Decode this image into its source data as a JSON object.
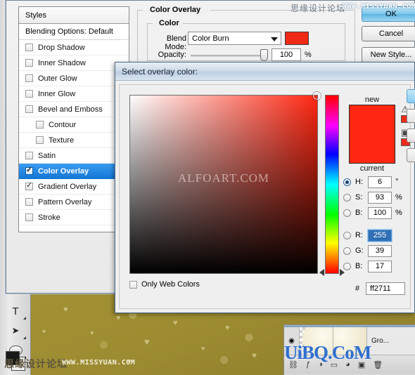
{
  "canvas": {
    "watermark_top_cn": "思缘设计论坛",
    "watermark_top_url": "WWW.MISSYUAN.COM",
    "watermark_bottom_cn": "思缘设计论坛",
    "watermark_bottom_url": "WWW.MISSYUAN.COM",
    "watermark_layers": "UiBQ.CoM"
  },
  "toolbar": {
    "tools": [
      {
        "name": "type-tool",
        "glyph": "T"
      },
      {
        "name": "path-selection-tool",
        "glyph": "➤"
      },
      {
        "name": "ellipse-shape-tool",
        "glyph": ""
      }
    ]
  },
  "layer_style": {
    "styles_panel": {
      "header": "Styles",
      "blending_options": "Blending Options: Default",
      "items": [
        {
          "label": "Drop Shadow",
          "checked": false,
          "selected": false,
          "indent": false
        },
        {
          "label": "Inner Shadow",
          "checked": false,
          "selected": false,
          "indent": false
        },
        {
          "label": "Outer Glow",
          "checked": false,
          "selected": false,
          "indent": false
        },
        {
          "label": "Inner Glow",
          "checked": false,
          "selected": false,
          "indent": false
        },
        {
          "label": "Bevel and Emboss",
          "checked": false,
          "selected": false,
          "indent": false
        },
        {
          "label": "Contour",
          "checked": false,
          "selected": false,
          "indent": true
        },
        {
          "label": "Texture",
          "checked": false,
          "selected": false,
          "indent": true
        },
        {
          "label": "Satin",
          "checked": false,
          "selected": false,
          "indent": false
        },
        {
          "label": "Color Overlay",
          "checked": true,
          "selected": true,
          "indent": false
        },
        {
          "label": "Gradient Overlay",
          "checked": true,
          "selected": false,
          "indent": false
        },
        {
          "label": "Pattern Overlay",
          "checked": false,
          "selected": false,
          "indent": false
        },
        {
          "label": "Stroke",
          "checked": false,
          "selected": false,
          "indent": false
        }
      ]
    },
    "color_overlay": {
      "section_title": "Color Overlay",
      "group_title": "Color",
      "blend_mode_label": "Blend Mode:",
      "blend_mode_value": "Color Burn",
      "blend_swatch_color": "#ee2a17",
      "opacity_label": "Opacity:",
      "opacity_value": "100",
      "opacity_unit": "%"
    },
    "buttons": {
      "ok": "OK",
      "cancel": "Cancel",
      "new_style": "New Style..."
    }
  },
  "color_picker": {
    "title": "Select overlay color:",
    "preview": {
      "new_label": "new",
      "current_label": "current",
      "new_color": "#ff2711",
      "current_color": "#ff2711",
      "warning_chip_color": "#ee2a17",
      "websafe_chip_color": "#ee2a17"
    },
    "field_watermark": "ALFOART.COM",
    "fields": [
      {
        "key": "H",
        "label": "H:",
        "value": "6",
        "unit": "°",
        "selected": true,
        "focused": false
      },
      {
        "key": "S",
        "label": "S:",
        "value": "93",
        "unit": "%",
        "selected": false,
        "focused": false
      },
      {
        "key": "B",
        "label": "B:",
        "value": "100",
        "unit": "%",
        "selected": false,
        "focused": false
      },
      {
        "key": "R",
        "label": "R:",
        "value": "255",
        "unit": "",
        "selected": false,
        "focused": true
      },
      {
        "key": "G",
        "label": "G:",
        "value": "39",
        "unit": "",
        "selected": false,
        "focused": false
      },
      {
        "key": "B2",
        "label": "B:",
        "value": "17",
        "unit": "",
        "selected": false,
        "focused": false
      }
    ],
    "hex_sign": "#",
    "hex_value": "ff2711",
    "only_web_colors_label": "Only Web Colors",
    "only_web_colors_checked": false
  },
  "layers": {
    "layer_name": "Gro...",
    "eye_icon": "◉"
  }
}
